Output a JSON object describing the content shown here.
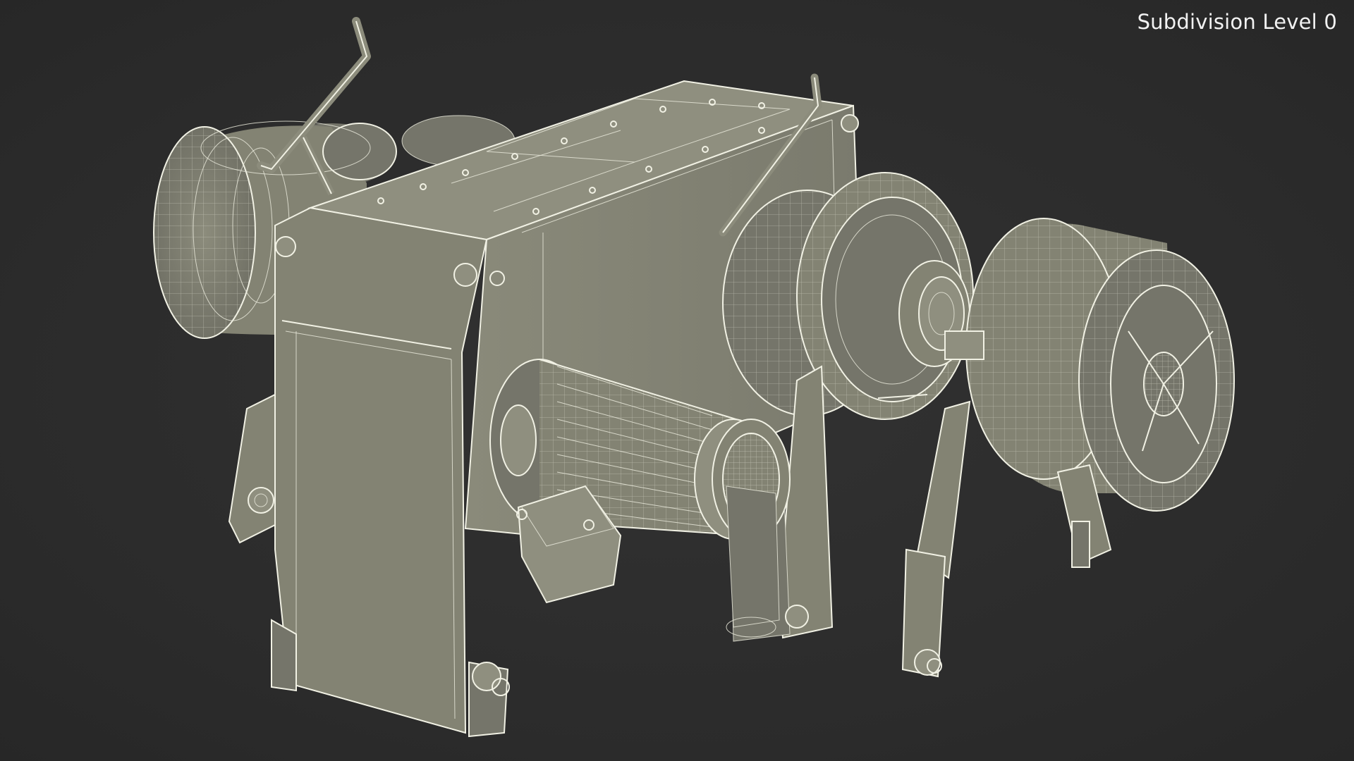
{
  "viewport": {
    "subdivision_label": "Subdivision Level 0",
    "background_color": "#2d2d2d",
    "model_color": "#838373",
    "wire_color": "#f1f1e4"
  },
  "model": {
    "parts": [
      "gearbox-housing",
      "electric-motor",
      "left-warping-drum",
      "right-warping-drum",
      "cable-lifter-wheel",
      "brake-handle-left",
      "brake-handle-right",
      "motor-terminal-box",
      "brake-band-arms"
    ]
  }
}
